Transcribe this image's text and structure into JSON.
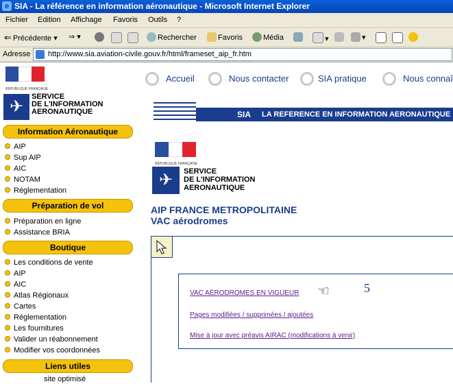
{
  "window": {
    "title": "SIA - La référence en information aéronautique - Microsoft Internet Explorer"
  },
  "menu": [
    "Fichier",
    "Edition",
    "Affichage",
    "Favoris",
    "Outils",
    "?"
  ],
  "toolbar": {
    "back": "Précédente",
    "search": "Rechercher",
    "favorites": "Favoris",
    "media": "Média"
  },
  "address": {
    "label": "Adresse",
    "url": "http://www.sia.aviation-civile.gouv.fr/html/frameset_aip_fr.htm"
  },
  "logo": {
    "republic": "RÉPUBLIQUE FRANÇAISE",
    "line1": "SERVICE",
    "line2": "DE L'INFORMATION",
    "line3": "AERONAUTIQUE"
  },
  "sidebar": {
    "sections": [
      {
        "title": "Information Aéronautique",
        "items": [
          "AIP",
          "Sup AIP",
          "AIC",
          "NOTAM",
          "Réglementation"
        ]
      },
      {
        "title": "Préparation de vol",
        "items": [
          "Préparation en ligne",
          "Assistance BRIA"
        ]
      },
      {
        "title": "Boutique",
        "items": [
          "Les conditions de vente",
          "AIP",
          "AIC",
          "Atlas Régionaux",
          "Cartes",
          "Réglementation",
          "Les fournitures",
          "Valider un réabonnement",
          "Modifier vos coordonnées"
        ]
      },
      {
        "title": "Liens utiles",
        "items": []
      }
    ],
    "footer": "site optimisé"
  },
  "topnav": [
    "Accueil",
    "Nous contacter",
    "SIA pratique",
    "Nous connaî"
  ],
  "banner": {
    "sia": "SIA",
    "tagline": "LA REFERENCE EN INFORMATION AERONAUTIQUE"
  },
  "content": {
    "heading1": "AIP FRANCE METROPOLITAINE",
    "heading2": "VAC aérodromes",
    "links": [
      "VAC AÉRODROMES EN VIGUEUR",
      "Pages modifiées / supprimées / ajoutées",
      "Mise à jour avec préavis AIRAC (modifications à venir)"
    ],
    "annotation": "5"
  },
  "colors": {
    "accent": "#1a3c8c",
    "section": "#f4c20d",
    "link": "#5a1a8a"
  }
}
